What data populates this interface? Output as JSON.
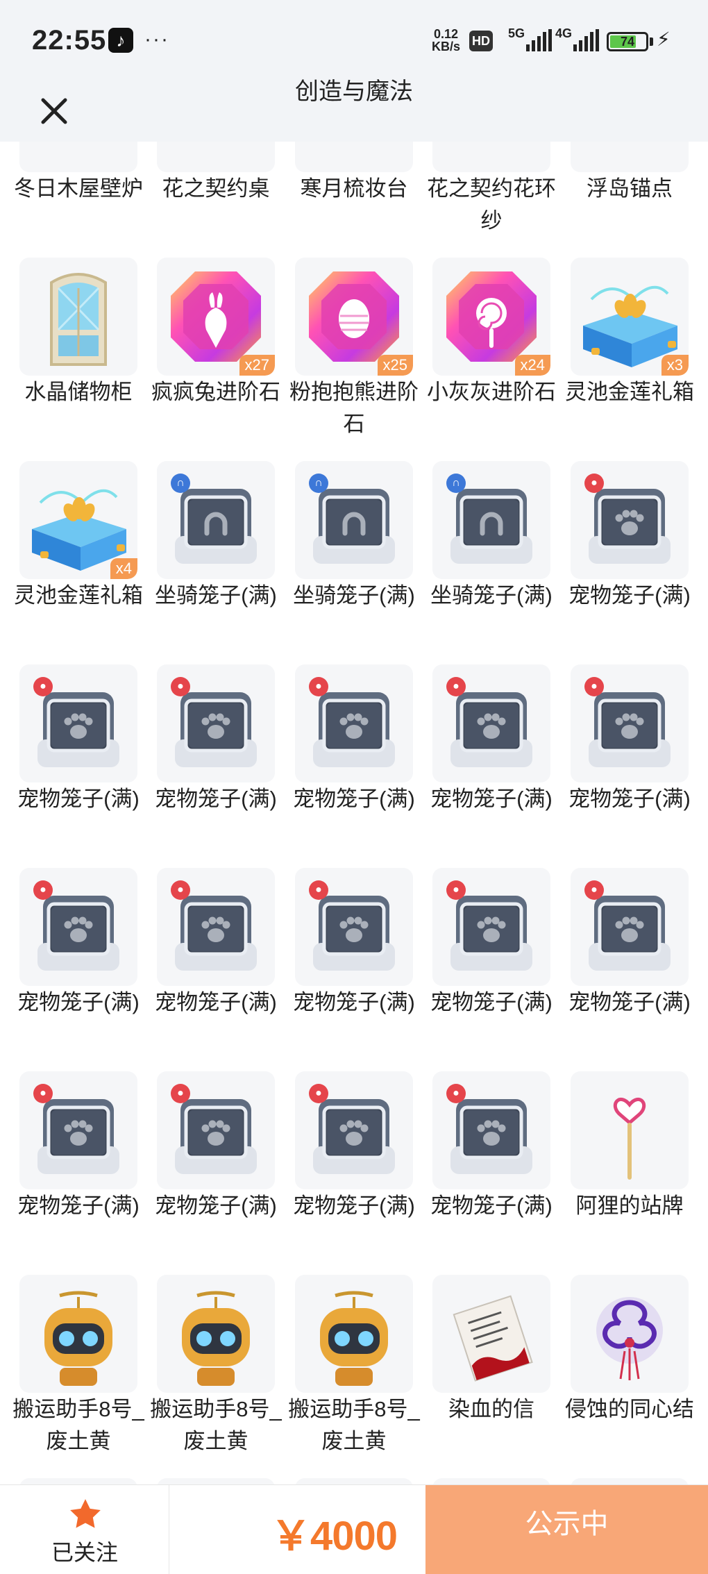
{
  "status": {
    "time": "22:55",
    "tiktok_glyph": "♪",
    "more": "···",
    "net_speed_top": "0.12",
    "net_speed_bottom": "KB/s",
    "hd": "HD",
    "net1": "5G",
    "net2": "4G",
    "battery": "74"
  },
  "header": {
    "title": "创造与魔法"
  },
  "items": [
    {
      "name": "冬日木屋壁炉",
      "icon": "fireplace-icon"
    },
    {
      "name": "花之契约桌",
      "icon": "table-icon"
    },
    {
      "name": "寒月梳妆台",
      "icon": "vanity-icon"
    },
    {
      "name": "花之契约花环纱",
      "icon": "veil-icon"
    },
    {
      "name": "浮岛锚点",
      "icon": "anchor-icon"
    },
    {
      "name": "水晶储物柜",
      "icon": "cabinet-icon"
    },
    {
      "name": "疯疯兔进阶石",
      "icon": "rabbit-gem-icon",
      "qty": "x27"
    },
    {
      "name": "粉抱抱熊进阶石",
      "icon": "egg-gem-icon",
      "qty": "x25"
    },
    {
      "name": "小灰灰进阶石",
      "icon": "lollipop-gem-icon",
      "qty": "x24"
    },
    {
      "name": "灵池金莲礼箱",
      "icon": "lotus-box-icon",
      "qty": "x3"
    },
    {
      "name": "灵池金莲礼箱",
      "icon": "lotus-box-icon",
      "qty": "x4"
    },
    {
      "name": "坐骑笼子(满)",
      "icon": "mount-cage-icon",
      "badge": "mount"
    },
    {
      "name": "坐骑笼子(满)",
      "icon": "mount-cage-icon",
      "badge": "mount"
    },
    {
      "name": "坐骑笼子(满)",
      "icon": "mount-cage-icon",
      "badge": "mount"
    },
    {
      "name": "宠物笼子(满)",
      "icon": "pet-cage-icon",
      "badge": "pet"
    },
    {
      "name": "宠物笼子(满)",
      "icon": "pet-cage-icon",
      "badge": "pet"
    },
    {
      "name": "宠物笼子(满)",
      "icon": "pet-cage-icon",
      "badge": "pet"
    },
    {
      "name": "宠物笼子(满)",
      "icon": "pet-cage-icon",
      "badge": "pet"
    },
    {
      "name": "宠物笼子(满)",
      "icon": "pet-cage-icon",
      "badge": "pet"
    },
    {
      "name": "宠物笼子(满)",
      "icon": "pet-cage-icon",
      "badge": "pet"
    },
    {
      "name": "宠物笼子(满)",
      "icon": "pet-cage-icon",
      "badge": "pet"
    },
    {
      "name": "宠物笼子(满)",
      "icon": "pet-cage-icon",
      "badge": "pet"
    },
    {
      "name": "宠物笼子(满)",
      "icon": "pet-cage-icon",
      "badge": "pet"
    },
    {
      "name": "宠物笼子(满)",
      "icon": "pet-cage-icon",
      "badge": "pet"
    },
    {
      "name": "宠物笼子(满)",
      "icon": "pet-cage-icon",
      "badge": "pet"
    },
    {
      "name": "宠物笼子(满)",
      "icon": "pet-cage-icon",
      "badge": "pet"
    },
    {
      "name": "宠物笼子(满)",
      "icon": "pet-cage-icon",
      "badge": "pet"
    },
    {
      "name": "宠物笼子(满)",
      "icon": "pet-cage-icon",
      "badge": "pet"
    },
    {
      "name": "宠物笼子(满)",
      "icon": "pet-cage-icon",
      "badge": "pet"
    },
    {
      "name": "阿狸的站牌",
      "icon": "sign-wand-icon"
    },
    {
      "name": "搬运助手8号_废土黄",
      "icon": "robot-icon"
    },
    {
      "name": "搬运助手8号_废土黄",
      "icon": "robot-icon"
    },
    {
      "name": "搬运助手8号_废土黄",
      "icon": "robot-icon"
    },
    {
      "name": "染血的信",
      "icon": "letter-icon"
    },
    {
      "name": "侵蚀的同心结",
      "icon": "knot-icon"
    }
  ],
  "bottom": {
    "follow_label": "已关注",
    "price": "￥4000",
    "status_button": "公示中"
  },
  "colors": {
    "accent": "#f4792c",
    "button": "#f8a777",
    "badge_qty": "#f59a52",
    "mount_badge": "#3d78d8",
    "pet_badge": "#e5454b",
    "star": "#f2692c"
  }
}
